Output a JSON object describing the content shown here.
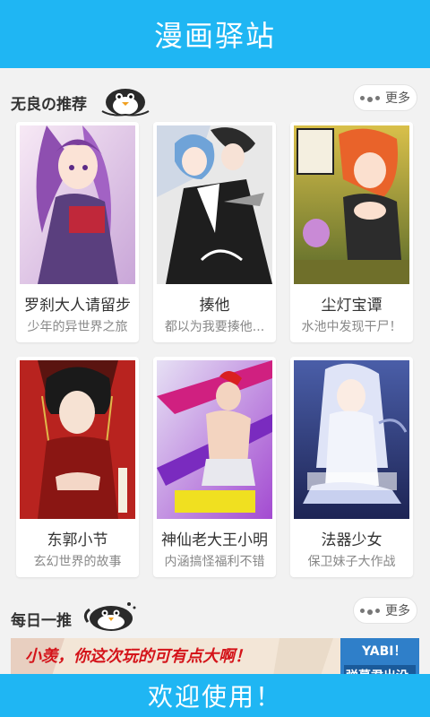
{
  "app": {
    "title": "漫画驿站"
  },
  "sections": [
    {
      "title": "无良の推荐",
      "more_label": "更多"
    },
    {
      "title": "每日一推",
      "more_label": "更多"
    }
  ],
  "comics": [
    {
      "title": "罗刹大人请留步",
      "desc": "少年的异世界之旅",
      "cover_text": "罗刹大人请留步"
    },
    {
      "title": "揍他",
      "desc": "都以为我要揍他...",
      "cover_text": "揍他"
    },
    {
      "title": "尘灯宝谭",
      "desc": "水池中发现干尸！",
      "cover_text": "尘灯宝谭"
    },
    {
      "title": "东郭小节",
      "desc": "玄幻世界的故事",
      "cover_text": "东郭小节"
    },
    {
      "title": "神仙老大王小明",
      "desc": "内涵搞怪福利不错",
      "cover_text": "神仙老大"
    },
    {
      "title": "法器少女",
      "desc": "保卫妹子大作战",
      "cover_text": "法器少女"
    }
  ],
  "banner": {
    "text": "小羡，你这次玩的可有点大啊！",
    "logo": "YABI！",
    "sub": "弹幕君出没"
  },
  "footer": {
    "welcome": "欢迎使用！"
  }
}
